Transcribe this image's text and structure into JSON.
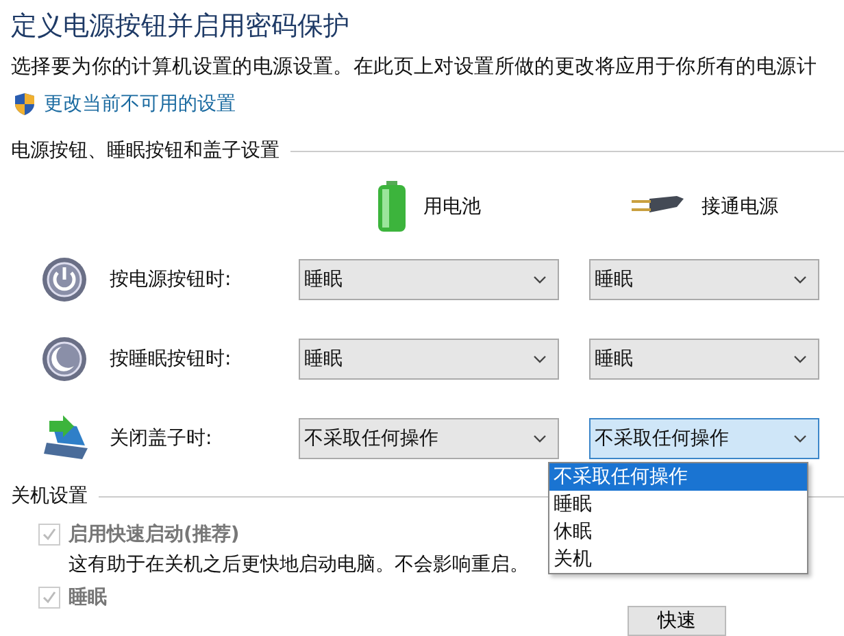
{
  "title": "定义电源按钮并启用密码保护",
  "description": "选择要为你的计算机设置的电源设置。在此页上对设置所做的更改将应用于你所有的电源计",
  "admin_link": "更改当前不可用的设置",
  "buttons_section": {
    "heading": "电源按钮、睡眠按钮和盖子设置",
    "columns": [
      {
        "kind": "battery",
        "label": "用电池"
      },
      {
        "kind": "plug",
        "label": "接通电源"
      }
    ],
    "rows": [
      {
        "kind": "power",
        "label": "按电源按钮时:",
        "battery": "睡眠",
        "plugged": "睡眠",
        "plugged_focused": false
      },
      {
        "kind": "sleep",
        "label": "按睡眠按钮时:",
        "battery": "睡眠",
        "plugged": "睡眠",
        "plugged_focused": false
      },
      {
        "kind": "lid",
        "label": "关闭盖子时:",
        "battery": "不采取任何操作",
        "plugged": "不采取任何操作",
        "plugged_focused": true
      }
    ],
    "open_list": [
      {
        "label": "不采取任何操作",
        "selected": true
      },
      {
        "label": "睡眠",
        "selected": false
      },
      {
        "label": "休眠",
        "selected": false
      },
      {
        "label": "关机",
        "selected": false
      }
    ]
  },
  "shutdown_section": {
    "heading": "关机设置",
    "options": [
      {
        "label": "启用快速启动(推荐)",
        "checked": true,
        "disabled": true,
        "note": "这有助于在关机之后更快地启动电脑。不会影响重启。"
      },
      {
        "label": "睡眠",
        "checked": true,
        "disabled": true
      }
    ],
    "button": "快速"
  }
}
